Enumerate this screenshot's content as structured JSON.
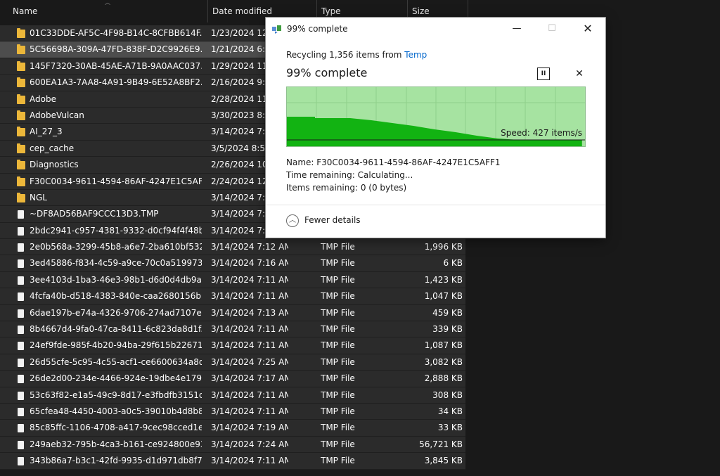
{
  "explorer": {
    "columns": {
      "name": "Name",
      "date": "Date modified",
      "type": "Type",
      "size": "Size"
    },
    "rows": [
      {
        "name": "01C33DDE-AF5C-4F98-B14C-8CFBB614F...",
        "date": "1/23/2024 12:",
        "type": "",
        "size": "",
        "icon": "folder-icon"
      },
      {
        "name": "5C56698A-309A-47FD-838F-D2C9926E9...",
        "date": "1/21/2024 6:5",
        "type": "",
        "size": "",
        "icon": "folder-icon"
      },
      {
        "name": "145F7320-30AB-45AE-A71B-9A0AAC037...",
        "date": "1/29/2024 11:",
        "type": "",
        "size": "",
        "icon": "folder-icon"
      },
      {
        "name": "600EA1A3-7AA8-4A91-9B49-6E52A8BF2...",
        "date": "2/16/2024 9:5",
        "type": "",
        "size": "",
        "icon": "folder-icon"
      },
      {
        "name": "Adobe",
        "date": "2/28/2024 11:",
        "type": "",
        "size": "",
        "icon": "folder-icon"
      },
      {
        "name": "AdobeVulcan",
        "date": "3/30/2023 8:3",
        "type": "",
        "size": "",
        "icon": "folder-icon"
      },
      {
        "name": "AI_27_3",
        "date": "3/14/2024 7:1",
        "type": "",
        "size": "",
        "icon": "folder-icon"
      },
      {
        "name": "cep_cache",
        "date": "3/5/2024 8:51",
        "type": "",
        "size": "",
        "icon": "folder-icon"
      },
      {
        "name": "Diagnostics",
        "date": "2/26/2024 10:",
        "type": "",
        "size": "",
        "icon": "folder-icon"
      },
      {
        "name": "F30C0034-9611-4594-86AF-4247E1C5AFF1",
        "date": "2/24/2024 12:",
        "type": "",
        "size": "",
        "icon": "folder-icon"
      },
      {
        "name": "NGL",
        "date": "3/14/2024 7:1",
        "type": "",
        "size": "",
        "icon": "folder-icon"
      },
      {
        "name": "~DF8AD56BAF9CCC13D3.TMP",
        "date": "3/14/2024 7:2",
        "type": "",
        "size": "",
        "icon": "file-icon"
      },
      {
        "name": "2bdc2941-c957-4381-9332-d0cf94f4f48b...",
        "date": "3/14/2024 7:1",
        "type": "",
        "size": "",
        "icon": "file-icon"
      },
      {
        "name": "2e0b568a-3299-45b8-a6e7-2ba610bf532...",
        "date": "3/14/2024 7:12 AM",
        "type": "TMP File",
        "size": "1,996 KB",
        "icon": "file-icon"
      },
      {
        "name": "3ed45886-f834-4c59-a9ce-70c0a519973...",
        "date": "3/14/2024 7:16 AM",
        "type": "TMP File",
        "size": "6 KB",
        "icon": "file-icon"
      },
      {
        "name": "3ee4103d-1ba3-46e3-98b1-d6d0d4db9a...",
        "date": "3/14/2024 7:11 AM",
        "type": "TMP File",
        "size": "1,423 KB",
        "icon": "file-icon"
      },
      {
        "name": "4fcfa40b-d518-4383-840e-caa2680156b...",
        "date": "3/14/2024 7:11 AM",
        "type": "TMP File",
        "size": "1,047 KB",
        "icon": "file-icon"
      },
      {
        "name": "6dae197b-e74a-4326-9706-274ad7107e...",
        "date": "3/14/2024 7:13 AM",
        "type": "TMP File",
        "size": "459 KB",
        "icon": "file-icon"
      },
      {
        "name": "8b4667d4-9fa0-47ca-8411-6c823da8d1f...",
        "date": "3/14/2024 7:11 AM",
        "type": "TMP File",
        "size": "339 KB",
        "icon": "file-icon"
      },
      {
        "name": "24ef9fde-985f-4b20-94ba-29f615b22671...",
        "date": "3/14/2024 7:11 AM",
        "type": "TMP File",
        "size": "1,087 KB",
        "icon": "file-icon"
      },
      {
        "name": "26d55cfe-5c95-4c55-acf1-ce6600634a8d...",
        "date": "3/14/2024 7:25 AM",
        "type": "TMP File",
        "size": "3,082 KB",
        "icon": "file-icon"
      },
      {
        "name": "26de2d00-234e-4466-924e-19dbe4e179...",
        "date": "3/14/2024 7:17 AM",
        "type": "TMP File",
        "size": "2,888 KB",
        "icon": "file-icon"
      },
      {
        "name": "53c63f82-e1a5-49c9-8d17-e3fbdfb3151c...",
        "date": "3/14/2024 7:11 AM",
        "type": "TMP File",
        "size": "308 KB",
        "icon": "file-icon"
      },
      {
        "name": "65cfea48-4450-4003-a0c5-39010b4d8b8...",
        "date": "3/14/2024 7:11 AM",
        "type": "TMP File",
        "size": "34 KB",
        "icon": "file-icon"
      },
      {
        "name": "85c85ffc-1106-4708-a417-9cec98cced1e...",
        "date": "3/14/2024 7:19 AM",
        "type": "TMP File",
        "size": "33 KB",
        "icon": "file-icon"
      },
      {
        "name": "249aeb32-795b-4ca3-b161-ce924800e93...",
        "date": "3/14/2024 7:24 AM",
        "type": "TMP File",
        "size": "56,721 KB",
        "icon": "file-icon"
      },
      {
        "name": "343b86a7-b3c1-42fd-9935-d1d971db8f7...",
        "date": "3/14/2024 7:11 AM",
        "type": "TMP File",
        "size": "3,845 KB",
        "icon": "file-icon"
      }
    ],
    "selected_index": 1
  },
  "dialog": {
    "title": "99% complete",
    "recycle_prefix": "Recycling 1,356 items from ",
    "recycle_link": "Temp",
    "heading": "99% complete",
    "progress_fraction": 0.99,
    "speed": "Speed: 427 items/s",
    "name_line": "Name: F30C0034-9611-4594-86AF-4247E1C5AFF1",
    "time_line": "Time remaining: Calculating...",
    "items_line": "Items remaining: 0 (0 bytes)",
    "fewer_details": "Fewer details",
    "pause_glyph": "II",
    "cancel_glyph": "✕",
    "min_glyph": "—",
    "max_glyph": "☐",
    "close_glyph": "✕",
    "chevron_glyph": "︿"
  },
  "colors": {
    "graph_bg": "#a6e3a1",
    "graph_fill": "#12b312",
    "link": "#0066cc",
    "folder": "#ecb73a"
  }
}
